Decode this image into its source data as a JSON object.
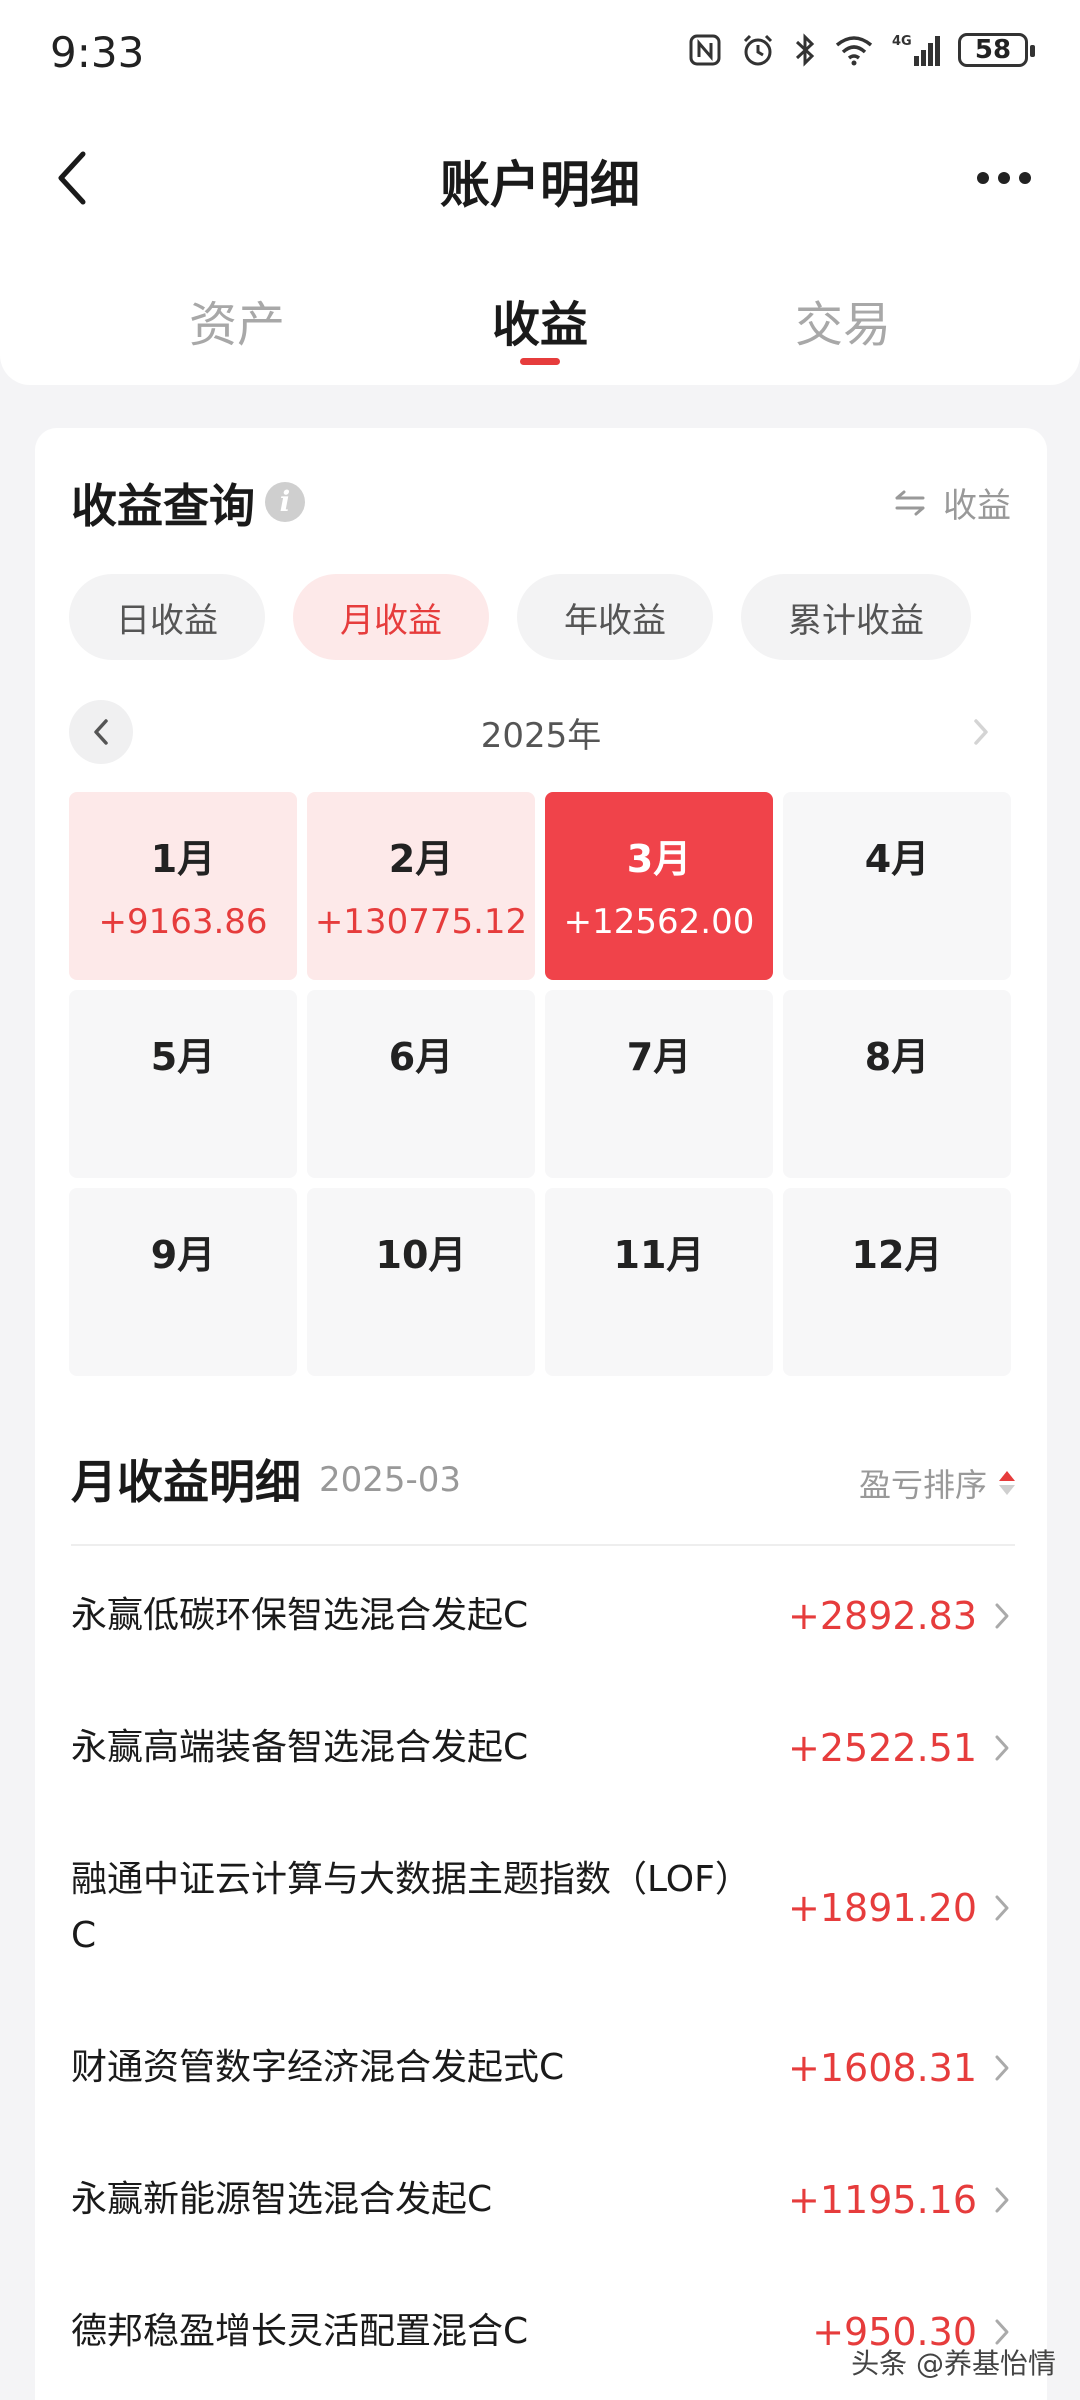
{
  "status_bar": {
    "time": "9:33",
    "network": "4G",
    "battery": "58"
  },
  "nav": {
    "title": "账户明细"
  },
  "tabs": [
    {
      "label": "资产",
      "active": false
    },
    {
      "label": "收益",
      "active": true
    },
    {
      "label": "交易",
      "active": false
    }
  ],
  "query": {
    "title": "收益查询",
    "switch_label": "收益",
    "segments": [
      {
        "label": "日收益",
        "active": false
      },
      {
        "label": "月收益",
        "active": true
      },
      {
        "label": "年收益",
        "active": false
      },
      {
        "label": "累计收益",
        "active": false
      }
    ],
    "year": "2025年",
    "months": [
      {
        "name": "1月",
        "value": "+9163.86",
        "state": "has-value"
      },
      {
        "name": "2月",
        "value": "+130775.12",
        "state": "has-value"
      },
      {
        "name": "3月",
        "value": "+12562.00",
        "state": "selected"
      },
      {
        "name": "4月",
        "value": "",
        "state": ""
      },
      {
        "name": "5月",
        "value": "",
        "state": ""
      },
      {
        "name": "6月",
        "value": "",
        "state": ""
      },
      {
        "name": "7月",
        "value": "",
        "state": ""
      },
      {
        "name": "8月",
        "value": "",
        "state": ""
      },
      {
        "name": "9月",
        "value": "",
        "state": ""
      },
      {
        "name": "10月",
        "value": "",
        "state": ""
      },
      {
        "name": "11月",
        "value": "",
        "state": ""
      },
      {
        "name": "12月",
        "value": "",
        "state": ""
      }
    ]
  },
  "detail": {
    "title": "月收益明细",
    "period": "2025-03",
    "sort_label": "盈亏排序",
    "funds": [
      {
        "name": "永赢低碳环保智选混合发起C",
        "value": "+2892.83"
      },
      {
        "name": "永赢高端装备智选混合发起C",
        "value": "+2522.51"
      },
      {
        "name": "融通中证云计算与大数据主题指数（LOF）C",
        "value": "+1891.20"
      },
      {
        "name": "财通资管数字经济混合发起式C",
        "value": "+1608.31"
      },
      {
        "name": "永赢新能源智选混合发起C",
        "value": "+1195.16"
      },
      {
        "name": "德邦稳盈增长灵活配置混合C",
        "value": "+950.30"
      }
    ]
  },
  "watermark": "头条 @养基怡情",
  "colors": {
    "accent": "#e63c3c",
    "selected_month": "#f0434a",
    "tinted_month": "#fde9e9"
  }
}
